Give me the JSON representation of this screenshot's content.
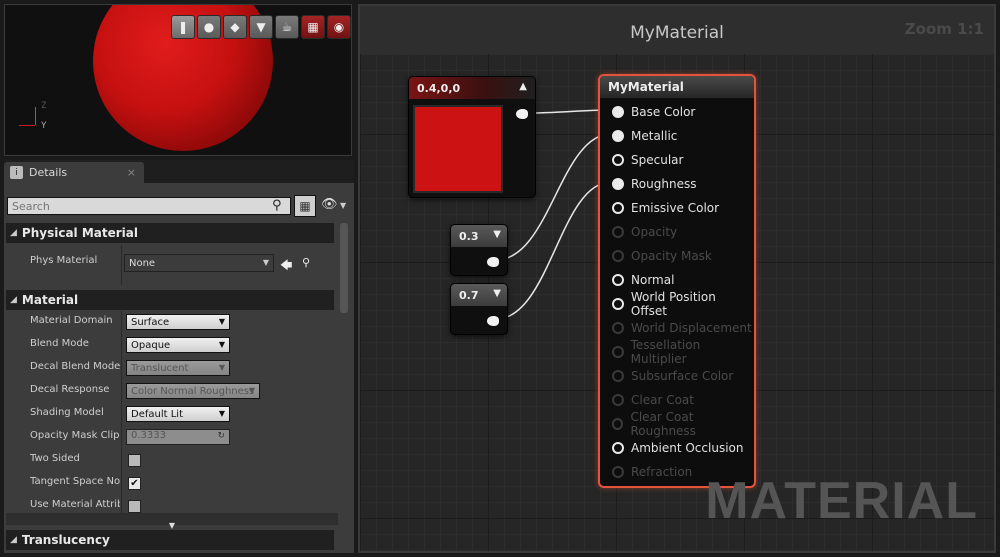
{
  "viewport": {
    "toolbar": [
      {
        "icon": "cylinder-icon",
        "glyph": "❚",
        "active": true
      },
      {
        "icon": "sphere-icon",
        "glyph": "●",
        "active": false
      },
      {
        "icon": "plane-icon",
        "glyph": "◆",
        "active": false
      },
      {
        "icon": "cube-icon",
        "glyph": "▼",
        "active": false
      },
      {
        "icon": "teapot-icon",
        "glyph": "☕",
        "active": false
      },
      {
        "icon": "grid-icon",
        "glyph": "▦",
        "active": false,
        "red": true
      },
      {
        "icon": "realtime-icon",
        "glyph": "◉",
        "active": false,
        "red": true
      }
    ],
    "axis": {
      "z": "Z",
      "y": "Y"
    }
  },
  "details": {
    "tab_label": "Details",
    "tab_close": "×",
    "search_placeholder": "Search",
    "categories": {
      "physical_material": "Physical Material",
      "material": "Material",
      "translucency": "Translucency"
    },
    "phys_material": {
      "label": "Phys Material",
      "value": "None"
    },
    "properties": [
      {
        "label": "Material Domain",
        "type": "combo",
        "value": "Surface",
        "enabled": true
      },
      {
        "label": "Blend Mode",
        "type": "combo",
        "value": "Opaque",
        "enabled": true
      },
      {
        "label": "Decal Blend Mode",
        "type": "combo",
        "value": "Translucent",
        "enabled": false
      },
      {
        "label": "Decal Response",
        "type": "combo",
        "value": "Color Normal Roughness",
        "enabled": false
      },
      {
        "label": "Shading Model",
        "type": "combo",
        "value": "Default Lit",
        "enabled": true
      },
      {
        "label": "Opacity Mask Clip",
        "type": "spin",
        "value": "0.3333",
        "enabled": false
      },
      {
        "label": "Two Sided",
        "type": "check",
        "checked": false
      },
      {
        "label": "Tangent Space Nor",
        "type": "check",
        "checked": true
      },
      {
        "label": "Use Material Attrib",
        "type": "check",
        "checked": false
      }
    ]
  },
  "graph": {
    "title": "MyMaterial",
    "zoom": "Zoom 1:1",
    "watermark": "MATERIAL",
    "nodes": {
      "color": {
        "label": "0.4,0,0",
        "swatch": "#cc1212"
      },
      "const1": {
        "label": "0.3"
      },
      "const2": {
        "label": "0.7"
      }
    },
    "result_node": {
      "title": "MyMaterial",
      "accent": "#e4543a",
      "pins": [
        {
          "label": "Base Color",
          "enabled": true,
          "connected": true
        },
        {
          "label": "Metallic",
          "enabled": true,
          "connected": true
        },
        {
          "label": "Specular",
          "enabled": true,
          "connected": false
        },
        {
          "label": "Roughness",
          "enabled": true,
          "connected": true
        },
        {
          "label": "Emissive Color",
          "enabled": true,
          "connected": false
        },
        {
          "label": "Opacity",
          "enabled": false,
          "connected": false
        },
        {
          "label": "Opacity Mask",
          "enabled": false,
          "connected": false
        },
        {
          "label": "Normal",
          "enabled": true,
          "connected": false
        },
        {
          "label": "World Position Offset",
          "enabled": true,
          "connected": false
        },
        {
          "label": "World Displacement",
          "enabled": false,
          "connected": false
        },
        {
          "label": "Tessellation Multiplier",
          "enabled": false,
          "connected": false
        },
        {
          "label": "Subsurface Color",
          "enabled": false,
          "connected": false
        },
        {
          "label": "Clear Coat",
          "enabled": false,
          "connected": false
        },
        {
          "label": "Clear Coat Roughness",
          "enabled": false,
          "connected": false
        },
        {
          "label": "Ambient Occlusion",
          "enabled": true,
          "connected": false
        },
        {
          "label": "Refraction",
          "enabled": false,
          "connected": false
        }
      ]
    }
  }
}
